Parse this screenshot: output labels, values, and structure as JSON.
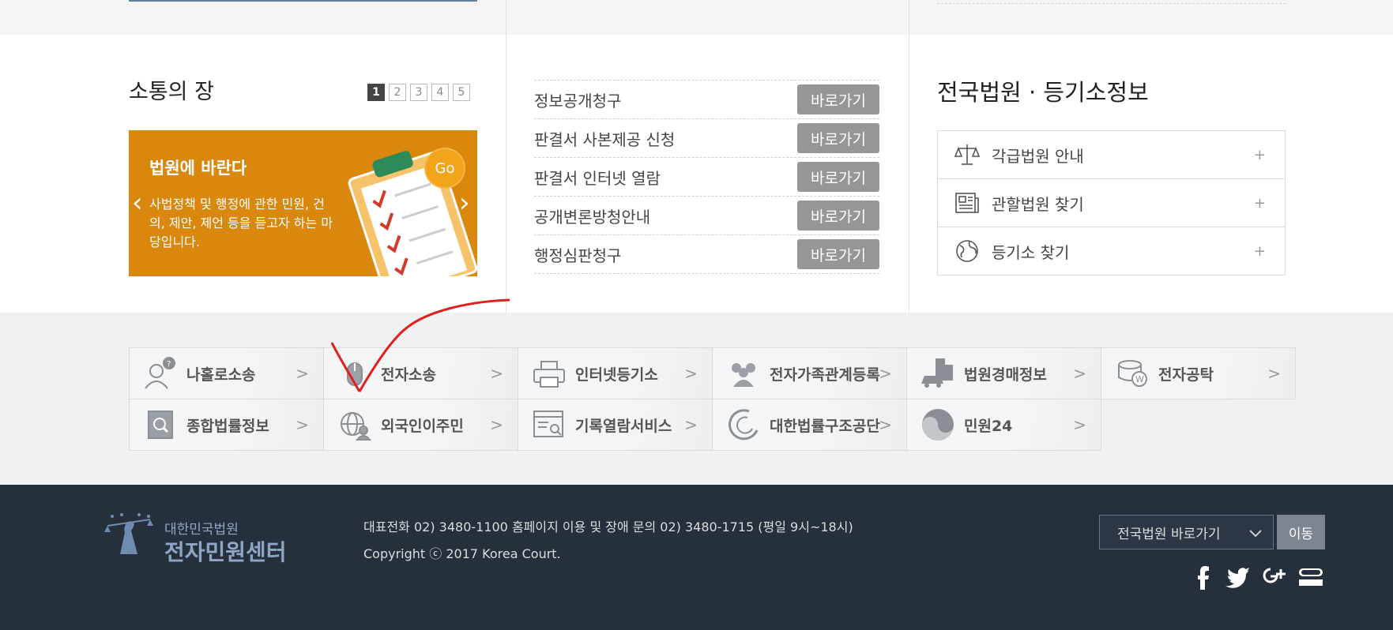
{
  "communication": {
    "title": "소통의 장",
    "pages": [
      "1",
      "2",
      "3",
      "4",
      "5"
    ],
    "active_page": "1",
    "banner": {
      "title": "법원에 바란다",
      "text": "사법정책 및 행정에 관한 민원, 건의, 제안, 제언 등을 듣고자 하는 마당입니다.",
      "go": "Go"
    }
  },
  "shortcuts": {
    "items": [
      {
        "label": "정보공개청구",
        "button": "바로가기"
      },
      {
        "label": "판결서 사본제공 신청",
        "button": "바로가기"
      },
      {
        "label": "판결서 인터넷 열람",
        "button": "바로가기"
      },
      {
        "label": "공개변론방청안내",
        "button": "바로가기"
      },
      {
        "label": "행정심판청구",
        "button": "바로가기"
      }
    ]
  },
  "court_info": {
    "title": "전국법원 · 등기소정보",
    "items": [
      {
        "label": "각급법원 안내",
        "icon": "scales-icon"
      },
      {
        "label": "관할법원 찾기",
        "icon": "newspaper-icon"
      },
      {
        "label": "등기소 찾기",
        "icon": "globe-icon"
      }
    ],
    "plus": "+"
  },
  "links": {
    "items": [
      {
        "label": "나홀로소송",
        "icon": "person-question-icon"
      },
      {
        "label": "전자소송",
        "icon": "mouse-icon"
      },
      {
        "label": "인터넷등기소",
        "icon": "printer-icon"
      },
      {
        "label": "전자가족관계등록",
        "icon": "family-icon"
      },
      {
        "label": "법원경매정보",
        "icon": "building-car-icon"
      },
      {
        "label": "전자공탁",
        "icon": "coins-icon"
      },
      {
        "label": "종합법률정보",
        "icon": "magnifier-book-icon"
      },
      {
        "label": "외국인이주민",
        "icon": "globe-person-icon"
      },
      {
        "label": "기록열람서비스",
        "icon": "document-search-icon"
      },
      {
        "label": "대한법률구조공단",
        "icon": "legal-aid-logo-icon"
      },
      {
        "label": "민원24",
        "icon": "taegeuk-icon"
      }
    ],
    "chevron": ">"
  },
  "footer": {
    "logo_small": "대한민국법원",
    "logo_big": "전자민원센터",
    "contact": "대표전화 02) 3480-1100 홈페이지 이용 및 장애 문의 02) 3480-1715 (평일 9시~18시)",
    "copyright": "Copyright ⓒ 2017 Korea Court.",
    "select_value": "전국법원 바로가기",
    "go_button": "이동",
    "social": [
      "facebook-icon",
      "twitter-icon",
      "google-plus-icon",
      "band-icon"
    ]
  },
  "colors": {
    "banner": "#d9870d",
    "footer": "#262f3c",
    "shortcut_button": "#969696",
    "annotation": "#e0201c"
  }
}
